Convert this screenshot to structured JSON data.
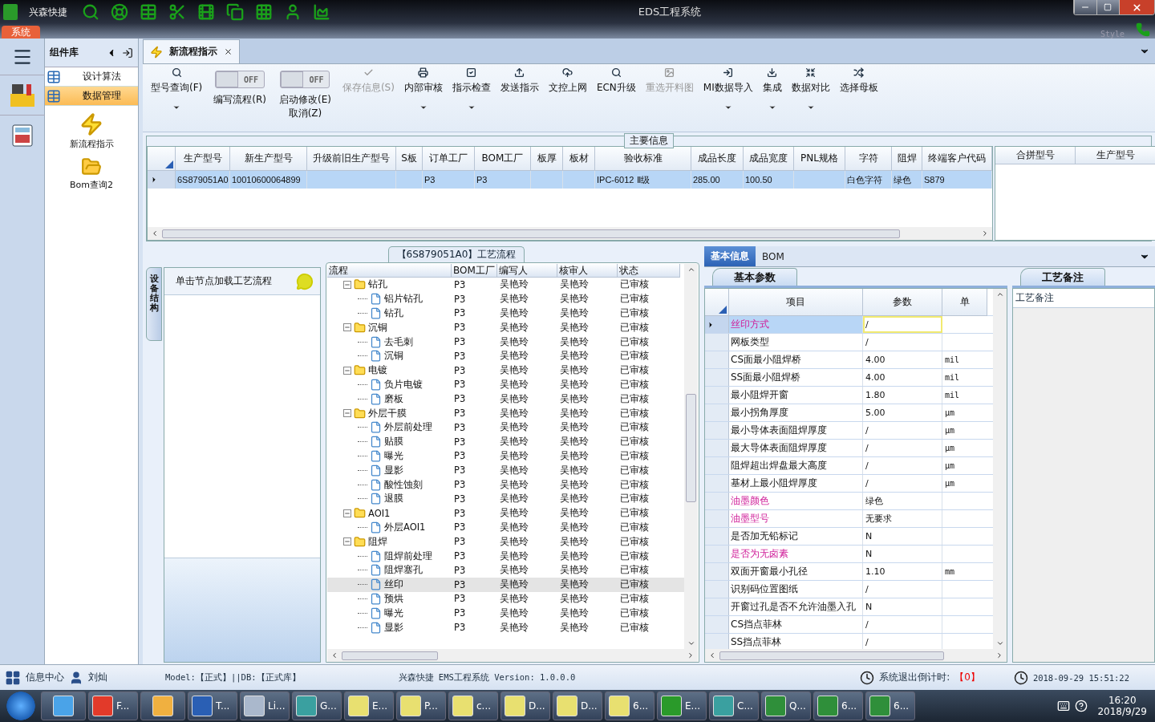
{
  "window": {
    "app_name": "兴森快捷",
    "title": "EDS工程系统",
    "style_label": "Style",
    "system_tab": "系统"
  },
  "sidebar": {
    "title": "组件库",
    "items": [
      {
        "label": "设计算法",
        "selected": false
      },
      {
        "label": "数据管理",
        "selected": true
      }
    ],
    "tools": [
      "新流程指示",
      "Bom查询2"
    ]
  },
  "document_tab": {
    "label": "新流程指示"
  },
  "toolbar": [
    {
      "kind": "button",
      "label": "型号查询(F)",
      "dropdown": true,
      "disabled": false
    },
    {
      "kind": "toggle",
      "label": "编写流程(R)",
      "state": "OFF",
      "on": false
    },
    {
      "kind": "toggle",
      "label": "启动修改(E)\n取消(Z)",
      "state": "OFF",
      "on": false
    },
    {
      "kind": "button",
      "label": "保存信息(S)",
      "dropdown": false,
      "disabled": true
    },
    {
      "kind": "button",
      "label": "内部审核",
      "dropdown": true,
      "disabled": false
    },
    {
      "kind": "button",
      "label": "指示检查",
      "dropdown": true,
      "disabled": false
    },
    {
      "kind": "button",
      "label": "发送指示",
      "dropdown": false,
      "disabled": false
    },
    {
      "kind": "button",
      "label": "文控上网",
      "dropdown": false,
      "disabled": false
    },
    {
      "kind": "button",
      "label": "ECN升级",
      "dropdown": false,
      "disabled": false
    },
    {
      "kind": "button",
      "label": "重选开料图",
      "dropdown": false,
      "disabled": true
    },
    {
      "kind": "button",
      "label": "MI数据导入",
      "dropdown": true,
      "disabled": false
    },
    {
      "kind": "button",
      "label": "集成",
      "dropdown": true,
      "disabled": false
    },
    {
      "kind": "button",
      "label": "数据对比",
      "dropdown": true,
      "disabled": false
    },
    {
      "kind": "button",
      "label": "选择母板",
      "dropdown": false,
      "disabled": false
    }
  ],
  "main_info": {
    "title": "主要信息",
    "columns": [
      "生产型号",
      "新生产型号",
      "升级前旧生产型号",
      "S板",
      "订单工厂",
      "BOM工厂",
      "板厚",
      "板材",
      "验收标准",
      "成品长度",
      "成品宽度",
      "PNL规格",
      "字符",
      "阻焊",
      "终端客户代码"
    ],
    "rows": [
      {
        "selected": true,
        "cells": [
          "6S879051A0",
          "10010600064899",
          "",
          "",
          "P3",
          "P3",
          "",
          "",
          "IPC-6012 Ⅱ级",
          "285.00",
          "100.50",
          "",
          "白色字符",
          "绿色",
          "S879"
        ]
      }
    ],
    "side_columns": [
      "合拼型号",
      "生产型号"
    ]
  },
  "left_panel": {
    "vertical_tab": "设备结构",
    "hint": "单击节点加载工艺流程"
  },
  "process": {
    "title": "【6S879051A0】工艺流程",
    "columns": [
      "流程",
      "BOM工厂",
      "编写人",
      "核审人",
      "状态"
    ],
    "tree": [
      {
        "name": "钻孔",
        "bom": "P3",
        "writer": "吴艳玲",
        "reviewer": "吴艳玲",
        "status": "已审核",
        "expanded": true,
        "selected": false,
        "children": [
          {
            "name": "铝片钻孔",
            "bom": "P3",
            "writer": "吴艳玲",
            "reviewer": "吴艳玲",
            "status": "已审核",
            "selected": false
          },
          {
            "name": "钻孔",
            "bom": "P3",
            "writer": "吴艳玲",
            "reviewer": "吴艳玲",
            "status": "已审核",
            "selected": false
          }
        ]
      },
      {
        "name": "沉铜",
        "bom": "P3",
        "writer": "吴艳玲",
        "reviewer": "吴艳玲",
        "status": "已审核",
        "expanded": true,
        "selected": false,
        "children": [
          {
            "name": "去毛刺",
            "bom": "P3",
            "writer": "吴艳玲",
            "reviewer": "吴艳玲",
            "status": "已审核",
            "selected": false
          },
          {
            "name": "沉铜",
            "bom": "P3",
            "writer": "吴艳玲",
            "reviewer": "吴艳玲",
            "status": "已审核",
            "selected": false
          }
        ]
      },
      {
        "name": "电镀",
        "bom": "P3",
        "writer": "吴艳玲",
        "reviewer": "吴艳玲",
        "status": "已审核",
        "expanded": true,
        "selected": false,
        "children": [
          {
            "name": "负片电镀",
            "bom": "P3",
            "writer": "吴艳玲",
            "reviewer": "吴艳玲",
            "status": "已审核",
            "selected": false
          },
          {
            "name": "磨板",
            "bom": "P3",
            "writer": "吴艳玲",
            "reviewer": "吴艳玲",
            "status": "已审核",
            "selected": false
          }
        ]
      },
      {
        "name": "外层干膜",
        "bom": "P3",
        "writer": "吴艳玲",
        "reviewer": "吴艳玲",
        "status": "已审核",
        "expanded": true,
        "selected": false,
        "children": [
          {
            "name": "外层前处理",
            "bom": "P3",
            "writer": "吴艳玲",
            "reviewer": "吴艳玲",
            "status": "已审核",
            "selected": false
          },
          {
            "name": "贴膜",
            "bom": "P3",
            "writer": "吴艳玲",
            "reviewer": "吴艳玲",
            "status": "已审核",
            "selected": false
          },
          {
            "name": "曝光",
            "bom": "P3",
            "writer": "吴艳玲",
            "reviewer": "吴艳玲",
            "status": "已审核",
            "selected": false
          },
          {
            "name": "显影",
            "bom": "P3",
            "writer": "吴艳玲",
            "reviewer": "吴艳玲",
            "status": "已审核",
            "selected": false
          },
          {
            "name": "酸性蚀刻",
            "bom": "P3",
            "writer": "吴艳玲",
            "reviewer": "吴艳玲",
            "status": "已审核",
            "selected": false
          },
          {
            "name": "退膜",
            "bom": "P3",
            "writer": "吴艳玲",
            "reviewer": "吴艳玲",
            "status": "已审核",
            "selected": false
          }
        ]
      },
      {
        "name": "AOI1",
        "bom": "P3",
        "writer": "吴艳玲",
        "reviewer": "吴艳玲",
        "status": "已审核",
        "expanded": true,
        "selected": false,
        "children": [
          {
            "name": "外层AOI1",
            "bom": "P3",
            "writer": "吴艳玲",
            "reviewer": "吴艳玲",
            "status": "已审核",
            "selected": false
          }
        ]
      },
      {
        "name": "阻焊",
        "bom": "P3",
        "writer": "吴艳玲",
        "reviewer": "吴艳玲",
        "status": "已审核",
        "expanded": true,
        "selected": false,
        "children": [
          {
            "name": "阻焊前处理",
            "bom": "P3",
            "writer": "吴艳玲",
            "reviewer": "吴艳玲",
            "status": "已审核",
            "selected": false
          },
          {
            "name": "阻焊塞孔",
            "bom": "P3",
            "writer": "吴艳玲",
            "reviewer": "吴艳玲",
            "status": "已审核",
            "selected": false
          },
          {
            "name": "丝印",
            "bom": "P3",
            "writer": "吴艳玲",
            "reviewer": "吴艳玲",
            "status": "已审核",
            "selected": true
          },
          {
            "name": "预烘",
            "bom": "P3",
            "writer": "吴艳玲",
            "reviewer": "吴艳玲",
            "status": "已审核",
            "selected": false
          },
          {
            "name": "曝光",
            "bom": "P3",
            "writer": "吴艳玲",
            "reviewer": "吴艳玲",
            "status": "已审核",
            "selected": false
          },
          {
            "name": "显影",
            "bom": "P3",
            "writer": "吴艳玲",
            "reviewer": "吴艳玲",
            "status": "已审核",
            "selected": false
          }
        ]
      }
    ]
  },
  "detail_tabs": [
    {
      "label": "基本信息",
      "selected": true
    },
    {
      "label": "BOM",
      "selected": false
    }
  ],
  "params": {
    "tab": "基本参数",
    "columns": [
      "项目",
      "参数",
      "单"
    ],
    "rows": [
      {
        "item": "丝印方式",
        "value": "/",
        "unit": "",
        "highlighted": true,
        "selected": true
      },
      {
        "item": "网板类型",
        "value": "/",
        "unit": "",
        "highlighted": false,
        "selected": false
      },
      {
        "item": "CS面最小阻焊桥",
        "value": "4.00",
        "unit": "mil",
        "highlighted": false,
        "selected": false
      },
      {
        "item": "SS面最小阻焊桥",
        "value": "4.00",
        "unit": "mil",
        "highlighted": false,
        "selected": false
      },
      {
        "item": "最小阻焊开窗",
        "value": "1.80",
        "unit": "mil",
        "highlighted": false,
        "selected": false
      },
      {
        "item": "最小拐角厚度",
        "value": "5.00",
        "unit": "μm",
        "highlighted": false,
        "selected": false
      },
      {
        "item": "最小导体表面阻焊厚度",
        "value": "/",
        "unit": "μm",
        "highlighted": false,
        "selected": false
      },
      {
        "item": "最大导体表面阻焊厚度",
        "value": "/",
        "unit": "μm",
        "highlighted": false,
        "selected": false
      },
      {
        "item": "阻焊超出焊盘最大高度",
        "value": "/",
        "unit": "μm",
        "highlighted": false,
        "selected": false
      },
      {
        "item": "基材上最小阻焊厚度",
        "value": "/",
        "unit": "μm",
        "highlighted": false,
        "selected": false
      },
      {
        "item": "油墨颜色",
        "value": "绿色",
        "unit": "",
        "highlighted": true,
        "selected": false
      },
      {
        "item": "油墨型号",
        "value": "无要求",
        "unit": "",
        "highlighted": true,
        "selected": false
      },
      {
        "item": "是否加无铅标记",
        "value": "N",
        "unit": "",
        "highlighted": false,
        "selected": false
      },
      {
        "item": "是否为无卤素",
        "value": "N",
        "unit": "",
        "highlighted": true,
        "selected": false
      },
      {
        "item": "双面开窗最小孔径",
        "value": "1.10",
        "unit": "mm",
        "highlighted": false,
        "selected": false
      },
      {
        "item": "识别码位置图纸",
        "value": "/",
        "unit": "",
        "highlighted": false,
        "selected": false
      },
      {
        "item": "开窗过孔是否不允许油墨入孔",
        "value": "N",
        "unit": "",
        "highlighted": false,
        "selected": false
      },
      {
        "item": "CS挡点菲林",
        "value": "/",
        "unit": "",
        "highlighted": false,
        "selected": false
      },
      {
        "item": "SS挡点菲林",
        "value": "/",
        "unit": "",
        "highlighted": false,
        "selected": false
      }
    ]
  },
  "notes": {
    "tab": "工艺备注",
    "label": "工艺备注"
  },
  "status_bar": {
    "info_center": "信息中心",
    "user": "刘灿",
    "model": "Model:【正式】||DB:【正式库】",
    "version": "兴森快捷 EMS工程系统 Version: 1.0.0.0",
    "countdown_label": "系统退出倒计时:",
    "countdown": "【0】",
    "datetime": "2018-09-29 15:51:22"
  },
  "taskbar": {
    "items": [
      {
        "kind": "icon"
      },
      {
        "kind": "app",
        "label": "F..."
      },
      {
        "kind": "icon"
      },
      {
        "kind": "app",
        "label": "T..."
      },
      {
        "kind": "app",
        "label": "Li..."
      },
      {
        "kind": "app",
        "label": "G..."
      },
      {
        "kind": "app",
        "label": "E..."
      },
      {
        "kind": "app",
        "label": "P..."
      },
      {
        "kind": "app",
        "label": "c..."
      },
      {
        "kind": "app",
        "label": "D..."
      },
      {
        "kind": "app",
        "label": "D..."
      },
      {
        "kind": "app",
        "label": "6..."
      },
      {
        "kind": "app",
        "label": "E..."
      },
      {
        "kind": "app",
        "label": "C..."
      },
      {
        "kind": "app",
        "label": "Q..."
      },
      {
        "kind": "app",
        "label": "6..."
      },
      {
        "kind": "app",
        "label": "6..."
      }
    ],
    "time": "16:20",
    "date": "2018/9/29"
  }
}
